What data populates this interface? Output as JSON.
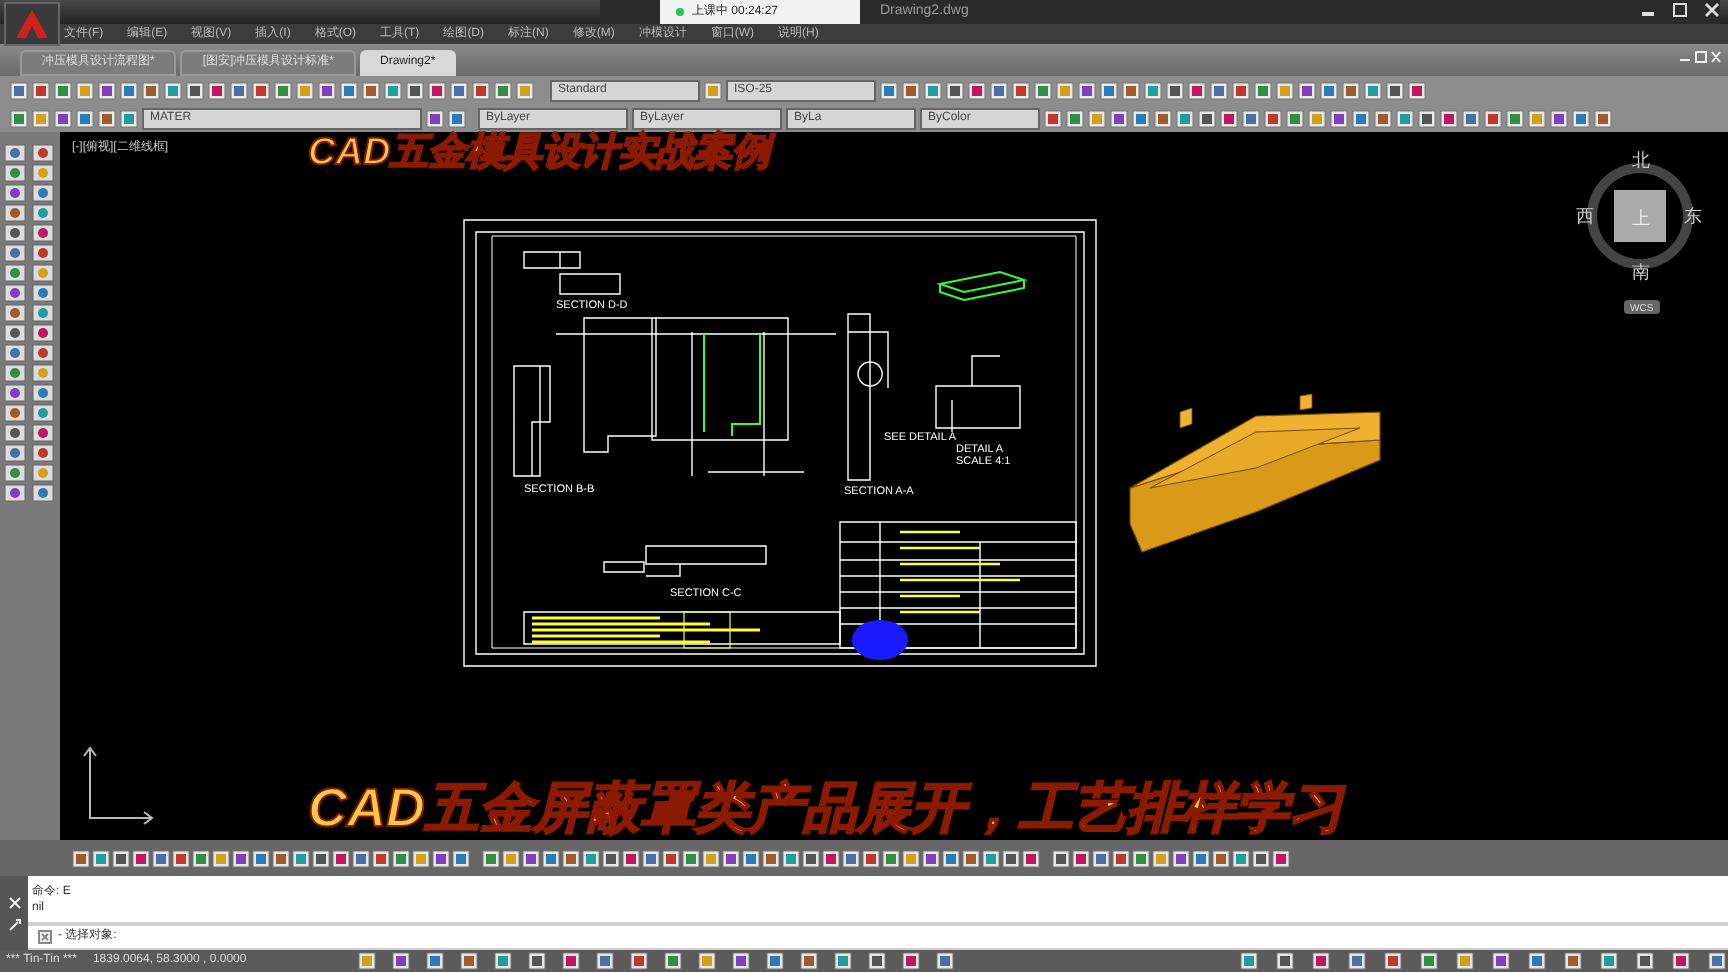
{
  "window": {
    "title": "Drawing2.dwg"
  },
  "timer": {
    "status": "上课中",
    "time": "00:24:27"
  },
  "menu": [
    "文件(F)",
    "编辑(E)",
    "视图(V)",
    "插入(I)",
    "格式(O)",
    "工具(T)",
    "绘图(D)",
    "标注(N)",
    "修改(M)",
    "冲模设计",
    "窗口(W)",
    "说明(H)"
  ],
  "file_tabs": [
    {
      "label": "冲压模具设计流程图*",
      "selected": false
    },
    {
      "label": "[图安]冲压模具设计标准*",
      "selected": false
    },
    {
      "label": "Drawing2*",
      "selected": true
    }
  ],
  "toolbar": {
    "text_style": "Standard",
    "dim_style": "ISO-25",
    "layer": "MATER",
    "color_setting": "ByLayer",
    "linetype": "ByLayer",
    "lineweight": "ByLa",
    "plot_style": "ByColor"
  },
  "viewport_label": "[-][俯视][二维线框]",
  "captions": [
    "CAD五金模具设计实战案例",
    "CAD五金屏蔽罩类产品展开，工艺排样学习"
  ],
  "drawing_labels": [
    "SECTION D-D",
    "SECTION B-B",
    "SECTION A-A",
    "SECTION C-C",
    "SEE DETAIL A",
    "DETAIL A",
    "SCALE 4:1"
  ],
  "viewcube": {
    "north": "北",
    "south": "南",
    "east": "东",
    "west": "西",
    "top": "上",
    "ucs": "WCS"
  },
  "command_history": [
    "命令: E",
    "nil"
  ],
  "command_prompt": "- 选择对象:",
  "status_bar": {
    "label": "*** Tin-Tin ***",
    "coordinates": "1839.0064, 58.3000 , 0.0000"
  }
}
